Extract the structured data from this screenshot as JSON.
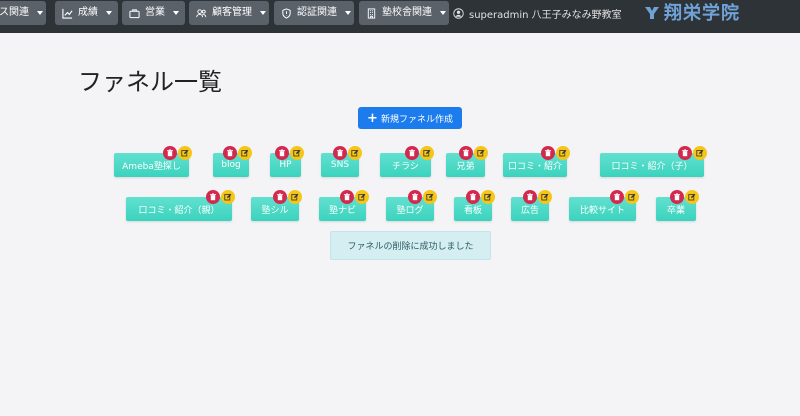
{
  "nav": {
    "items": [
      {
        "label": "ス関連"
      },
      {
        "label": "成績"
      },
      {
        "label": "営業"
      },
      {
        "label": "顧客管理"
      },
      {
        "label": "認証関連"
      },
      {
        "label": "塾校舎関連"
      }
    ],
    "user_label": "superadmin 八王子みなみ野教室",
    "brand_name": "翔栄学院"
  },
  "page": {
    "title": "ファネル一覧",
    "create_button_label": "新規ファネル作成",
    "alert_message": "ファネルの削除に成功しました"
  },
  "funnels": [
    {
      "label": "Ameba塾探し"
    },
    {
      "label": "blog"
    },
    {
      "label": "HP"
    },
    {
      "label": "SNS"
    },
    {
      "label": "チラシ"
    },
    {
      "label": "兄弟"
    },
    {
      "label": "口コミ・紹介"
    },
    {
      "label": "口コミ・紹介（子）"
    },
    {
      "label": "口コミ・紹介（親）"
    },
    {
      "label": "塾シル"
    },
    {
      "label": "塾ナビ"
    },
    {
      "label": "塾ログ"
    },
    {
      "label": "看板"
    },
    {
      "label": "広告"
    },
    {
      "label": "比較サイト"
    },
    {
      "label": "卒業"
    }
  ],
  "colors": {
    "navbar": "#2e3338",
    "nav_button": "#5a6168",
    "chip": "#3ad3bd",
    "delete": "#d22a4e",
    "edit": "#f5c518",
    "primary": "#1c7ced",
    "alert_bg": "#d4eef1"
  }
}
